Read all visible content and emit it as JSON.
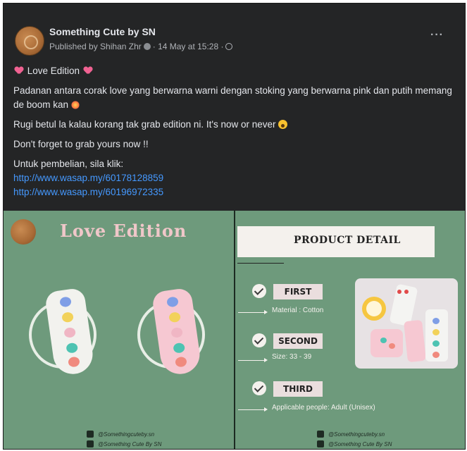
{
  "post": {
    "page_name": "Something Cute by SN",
    "published_by": "Published by Shihan Zhr",
    "timestamp": "· 14 May at 15:28 ·",
    "more_label": "···"
  },
  "body": {
    "line1": "Love Edition",
    "line2": "Padanan antara corak love yang berwarna warni dengan stoking yang berwarna pink dan putih memang de boom kan",
    "line3": "Rugi betul la kalau korang tak grab edition ni. It's now or never",
    "line4": "Don't forget to grab yours now !!",
    "line5": "Untuk pembelian, sila klik:",
    "link1": "http://www.wasap.my/60178128859",
    "link2": "http://www.wasap.my/60196972335"
  },
  "image": {
    "left_title": "Love Edition",
    "right_title": "PRODUCT DETAIL",
    "first_label": "FIRST",
    "first_spec": "Material : Cotton",
    "second_label": "SECOND",
    "second_spec": "Size: 33 - 39",
    "third_label": "THIRD",
    "third_spec": "Applicable people: Adult (Unisex)",
    "instagram_handle": "@Somethingcuteby.sn",
    "facebook_handle": "@Something Cute By SN"
  },
  "colors": {
    "background": "#242526",
    "text": "#e4e6eb",
    "link": "#4599ff",
    "image_green": "#6e9a7c",
    "title_pink": "#f0c7c9"
  }
}
